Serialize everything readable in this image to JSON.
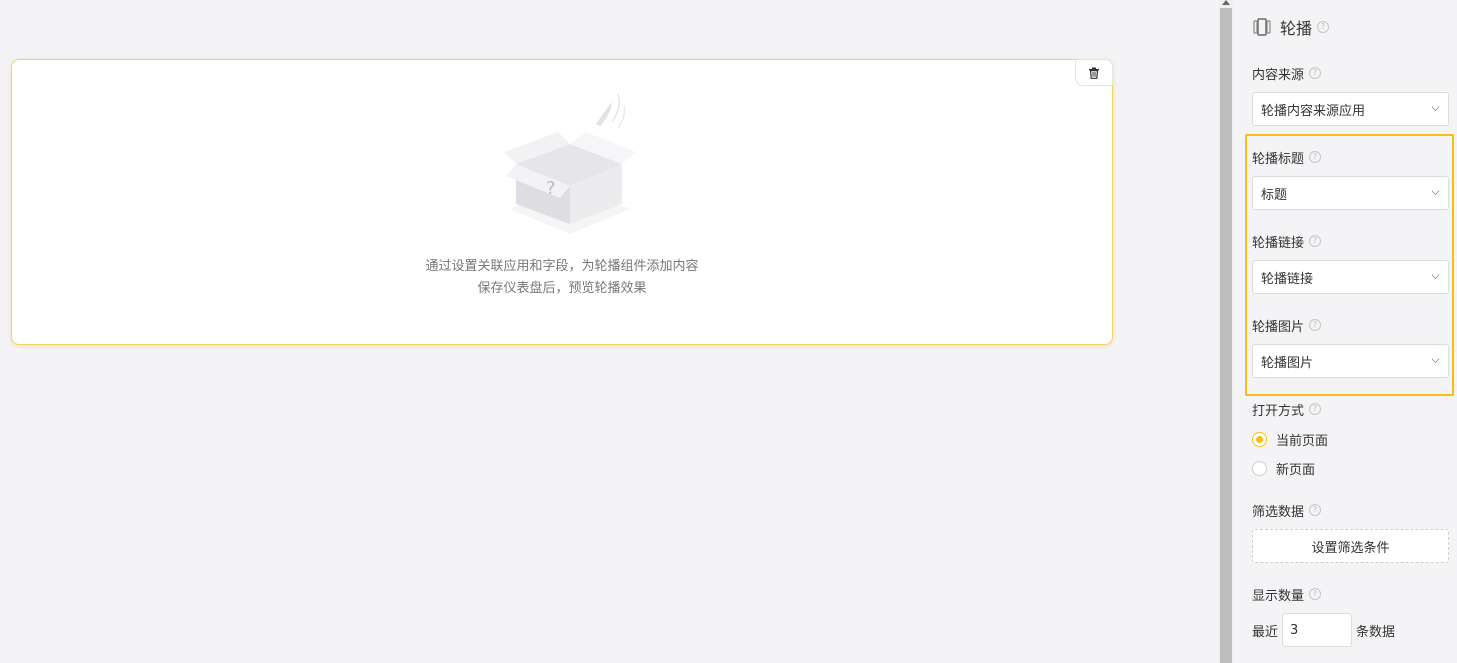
{
  "canvas": {
    "widget": {
      "empty_line1": "通过设置关联应用和字段，为轮播组件添加内容",
      "empty_line2": "保存仪表盘后，预览轮播效果",
      "delete_icon": "trash-icon"
    }
  },
  "panel": {
    "title": "轮播",
    "title_icon": "carousel-icon",
    "help_glyph": "?",
    "content_source": {
      "label": "内容来源",
      "value": "轮播内容来源应用"
    },
    "carousel_title": {
      "label": "轮播标题",
      "value": "标题"
    },
    "carousel_link": {
      "label": "轮播链接",
      "value": "轮播链接"
    },
    "carousel_image": {
      "label": "轮播图片",
      "value": "轮播图片"
    },
    "open_mode": {
      "label": "打开方式",
      "options": [
        "当前页面",
        "新页面"
      ],
      "selected": "当前页面"
    },
    "filter": {
      "label": "筛选数据",
      "button": "设置筛选条件"
    },
    "display_count": {
      "label": "显示数量",
      "prefix": "最近",
      "value": "3",
      "suffix": "条数据"
    }
  },
  "colors": {
    "accent": "#f6be17",
    "card_border": "#f5cf6a",
    "background": "#f4f4f6"
  }
}
